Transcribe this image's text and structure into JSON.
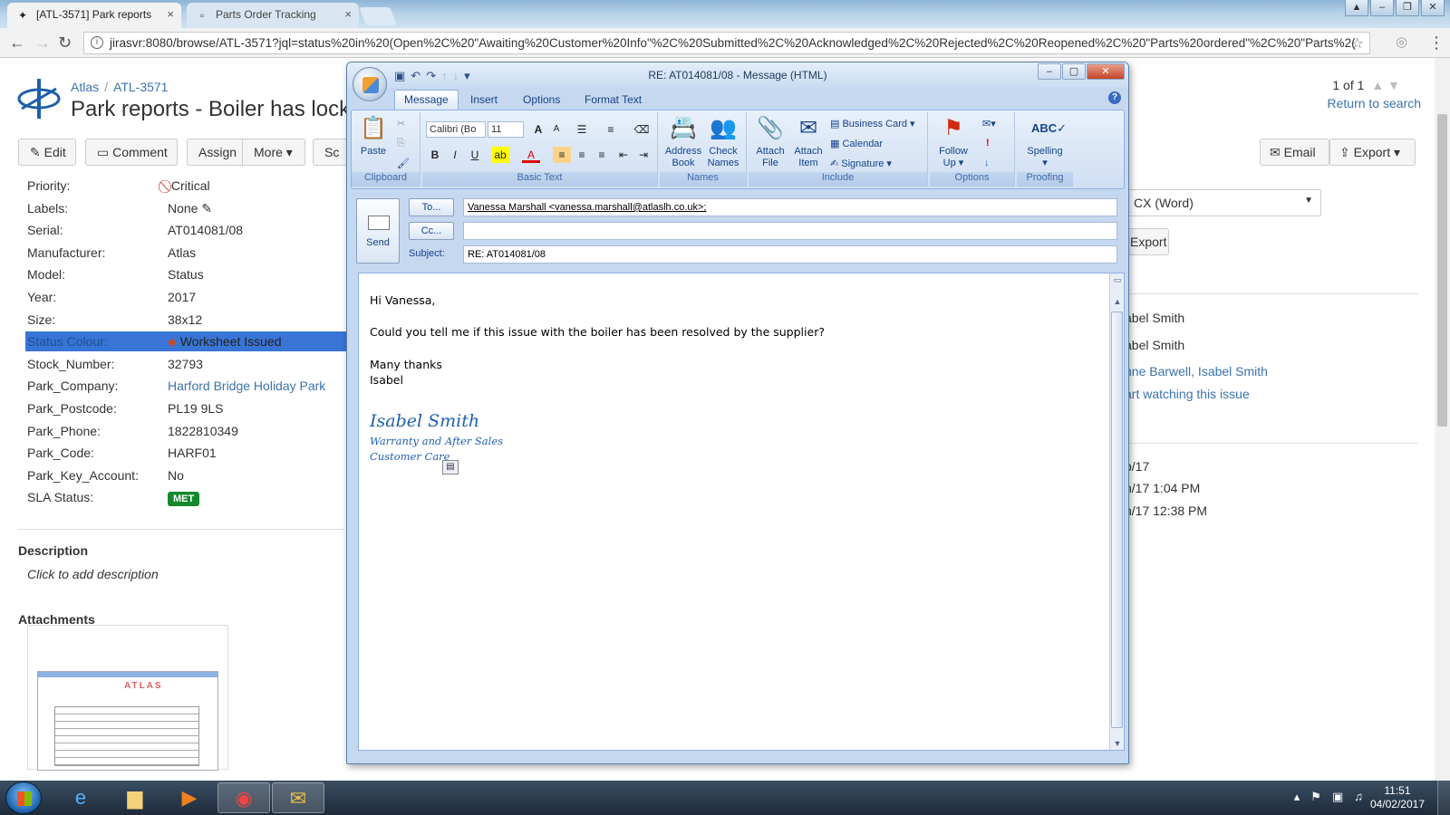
{
  "browser": {
    "tabs": [
      {
        "title": "[ATL-3571] Park reports",
        "active": true
      },
      {
        "title": "Parts Order Tracking",
        "active": false
      }
    ],
    "url": "jirasvr:8080/browse/ATL-3571?jql=status%20in%20(Open%2C%20\"Awaiting%20Customer%20Info\"%2C%20Submitted%2C%20Acknowledged%2C%20Rejected%2C%20Reopened%2C%20\"Parts%20ordered\"%2C%20\"Parts%2("
  },
  "jira": {
    "breadcrumb": {
      "project": "Atlas",
      "issue_key": "ATL-3571"
    },
    "title": "Park reports - Boiler has lock",
    "pager": "1 of 1",
    "return_to_search": "Return to search",
    "ops": {
      "edit": "Edit",
      "comment": "Comment",
      "assign": "Assign",
      "more": "More",
      "sch": "Sc"
    },
    "right_ops": {
      "email": "Email",
      "export": "Export"
    },
    "fields": [
      {
        "label": "Priority:",
        "value": "Critical"
      },
      {
        "label": "Labels:",
        "value": "None"
      },
      {
        "label": "Serial:",
        "value": "AT014081/08"
      },
      {
        "label": "Manufacturer:",
        "value": "Atlas"
      },
      {
        "label": "Model:",
        "value": "Status"
      },
      {
        "label": "Year:",
        "value": "2017"
      },
      {
        "label": "Size:",
        "value": "38x12"
      },
      {
        "label": "Status Colour:",
        "value": "Worksheet Issued"
      },
      {
        "label": "Stock_Number:",
        "value": "32793"
      },
      {
        "label": "Park_Company:",
        "value": "Harford Bridge Holiday Park"
      },
      {
        "label": "Park_Postcode:",
        "value": "PL19 9LS"
      },
      {
        "label": "Park_Phone:",
        "value": "1822810349"
      },
      {
        "label": "Park_Code:",
        "value": "HARF01"
      },
      {
        "label": "Park_Key_Account:",
        "value": "No"
      },
      {
        "label": "SLA Status:",
        "value": "MET"
      }
    ],
    "description_heading": "Description",
    "description_placeholder": "Click to add description",
    "attachments_heading": "Attachments",
    "attachment_doc_title": "ATLAS",
    "right": {
      "export_format": "CX (Word)",
      "export_button": "Export",
      "people": [
        "abel Smith",
        "abel Smith"
      ],
      "watchers": "nne Barwell, Isabel Smith",
      "watch_link": "art watching this issue",
      "dates": [
        "b/17",
        "n/17 1:04 PM",
        "n/17 12:38 PM"
      ]
    }
  },
  "outlook": {
    "window_title": "RE: AT014081/08  -  Message (HTML)",
    "ribbon_tabs": [
      "Message",
      "Insert",
      "Options",
      "Format Text"
    ],
    "groups": {
      "clipboard": "Clipboard",
      "basic_text": "Basic Text",
      "names": "Names",
      "include": "Include",
      "options": "Options",
      "proofing": "Proofing"
    },
    "buttons": {
      "paste": "Paste",
      "address_book_1": "Address",
      "address_book_2": "Book",
      "check_names_1": "Check",
      "check_names_2": "Names",
      "attach_file_1": "Attach",
      "attach_file_2": "File",
      "attach_item_1": "Attach",
      "attach_item_2": "Item",
      "business_card": "Business Card",
      "calendar": "Calendar",
      "signature": "Signature",
      "follow_up_1": "Follow",
      "follow_up_2": "Up",
      "spelling": "Spelling",
      "send": "Send",
      "to": "To...",
      "cc": "Cc..."
    },
    "font_name": "Calibri (Bo",
    "font_size": "11",
    "to_value": "Vanessa Marshall <vanessa.marshall@atlaslh.co.uk>;",
    "cc_value": "",
    "subject_label": "Subject:",
    "subject_value": "RE: AT014081/08",
    "body": {
      "greeting": "Hi Vanessa,",
      "line1": "Could you tell me if this issue with the boiler has been resolved by the supplier?",
      "closing": "Many thanks",
      "sender": "Isabel"
    },
    "signature": {
      "name": "Isabel Smith",
      "line1": "Warranty and After Sales",
      "line2": "Customer Care"
    }
  },
  "taskbar": {
    "time": "11:51",
    "date": "04/02/2017"
  },
  "colors": {
    "jira_link": "#3b73af",
    "selection": "#3875d7",
    "sla_met": "#14892c",
    "critical": "#d04437",
    "signature": "#1f5fb0"
  }
}
